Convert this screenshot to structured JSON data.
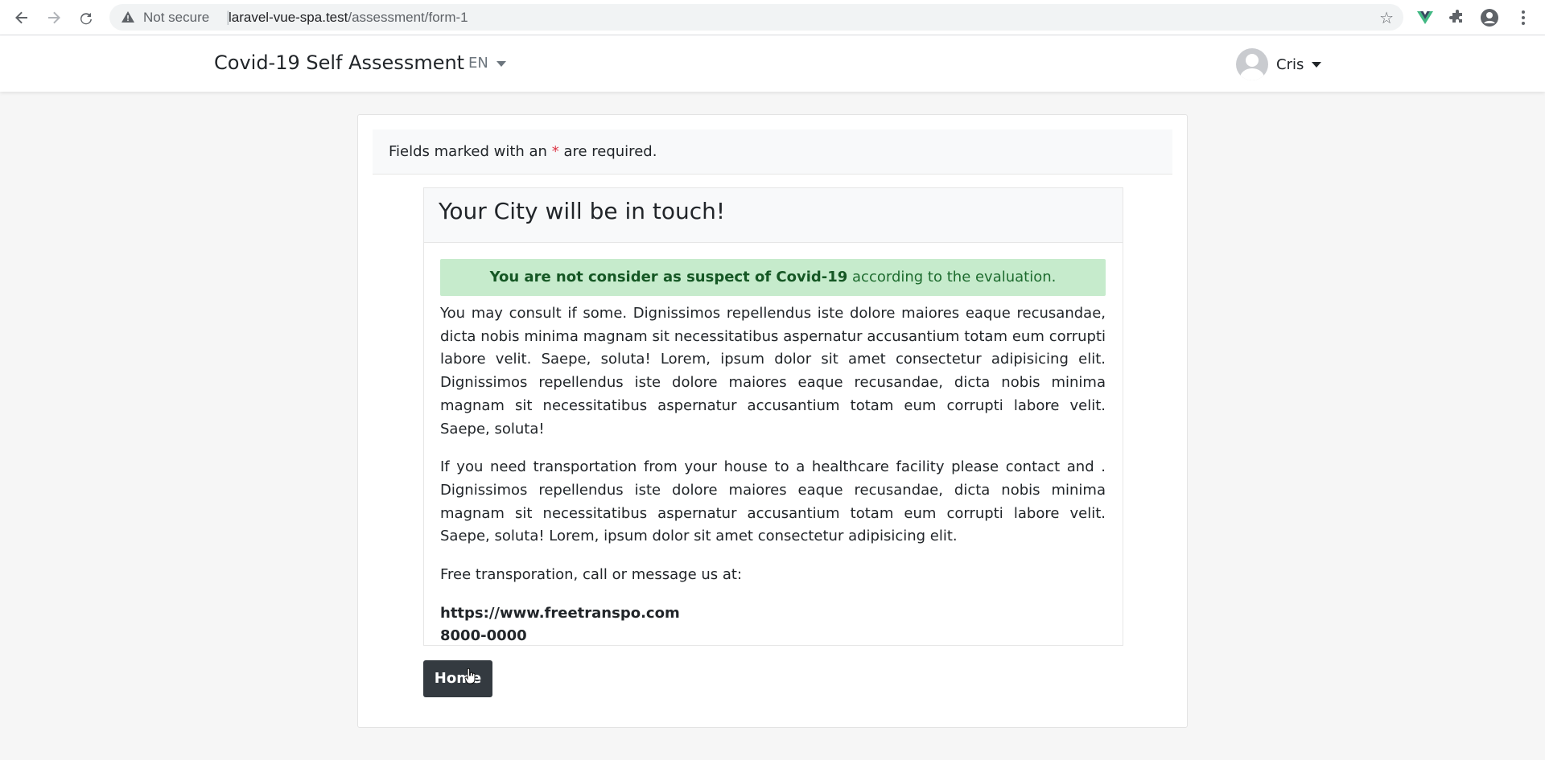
{
  "browser": {
    "security_label": "Not secure",
    "url_host": "laravel-vue-spa.test",
    "url_path": "/assessment/form-1"
  },
  "navbar": {
    "brand": "Covid-19 Self Assessment",
    "language": "EN",
    "user_name": "Cris"
  },
  "form": {
    "required_prefix": "Fields marked with an",
    "required_asterisk": "*",
    "required_suffix": "are required.",
    "card_title": "Your City will be in touch!",
    "alert_strong": "You are not consider as suspect of Covid-19",
    "alert_rest": "according to the evaluation.",
    "paragraph_1": "You may consult if some. Dignissimos repellendus iste dolore maiores eaque recusandae, dicta nobis minima magnam sit necessitatibus aspernatur accusantium totam eum corrupti labore velit. Saepe, soluta! Lorem, ipsum dolor sit amet consectetur adipisicing elit. Dignissimos repellendus iste dolore maiores eaque recusandae, dicta nobis minima magnam sit necessitatibus aspernatur accusantium totam eum corrupti labore velit. Saepe, soluta!",
    "paragraph_2": "If you need transportation from your house to a healthcare facility please contact and . Dignissimos repellendus iste dolore maiores eaque recusandae, dicta nobis minima magnam sit necessitatibus aspernatur accusantium totam eum corrupti labore velit. Saepe, soluta! Lorem, ipsum dolor sit amet consectetur adipisicing elit.",
    "paragraph_3": "Free transporation, call or message us at:",
    "contact_url": "https://www.freetranspo.com",
    "contact_phone": "8000-0000",
    "home_button": "Home"
  },
  "colors": {
    "alert_bg": "#c6ebcc",
    "alert_text": "#155724",
    "button_bg": "#343a40",
    "required_asterisk": "#dc3545"
  }
}
